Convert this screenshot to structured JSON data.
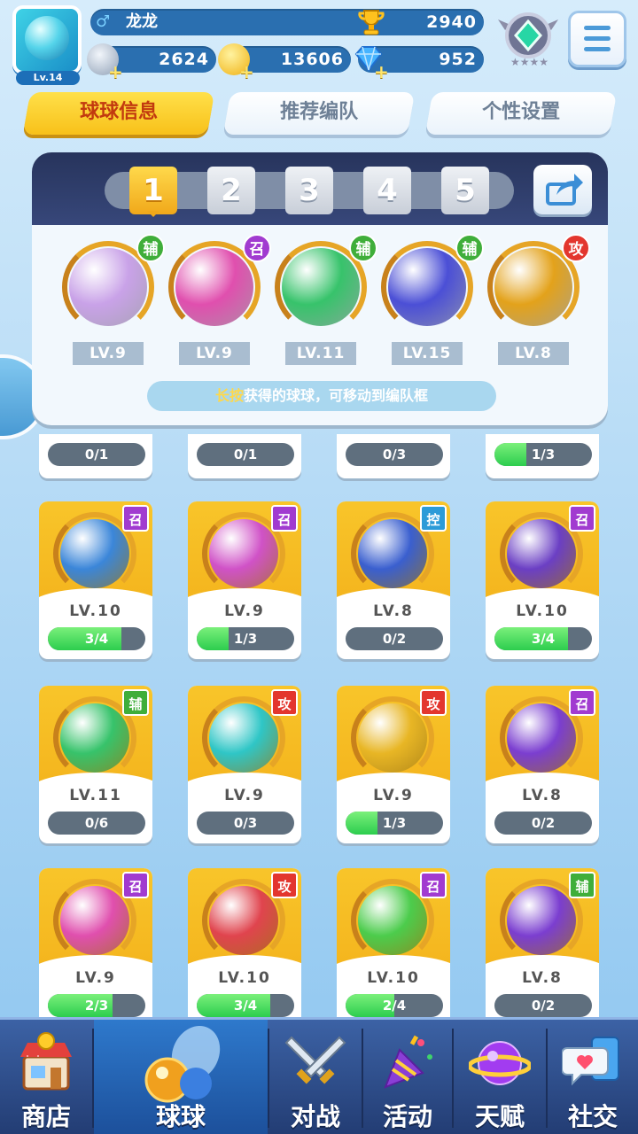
{
  "header": {
    "avatar_level": "Lv.14",
    "gender_icon": "♂",
    "player_name": "龙龙",
    "trophy_score": "2940",
    "silver_coins": "2624",
    "gold_coins": "13606",
    "diamonds": "952"
  },
  "tabs": [
    {
      "label": "球球信息",
      "active": true
    },
    {
      "label": "推荐编队",
      "active": false
    },
    {
      "label": "个性设置",
      "active": false
    }
  ],
  "team": {
    "slots": [
      "1",
      "2",
      "3",
      "4",
      "5"
    ],
    "active_slot": "1",
    "balls": [
      {
        "type": "辅",
        "level": "LV.9",
        "color": "#c9a2e8"
      },
      {
        "type": "召",
        "level": "LV.9",
        "color": "#e04fae"
      },
      {
        "type": "辅",
        "level": "LV.11",
        "color": "#37c36b"
      },
      {
        "type": "辅",
        "level": "LV.15",
        "color": "#4b4fd6"
      },
      {
        "type": "攻",
        "level": "LV.8",
        "color": "#e3a21b"
      }
    ],
    "hint_key": "长按",
    "hint_rest": "获得的球球，可移动到编队框"
  },
  "stub_row": [
    {
      "progress": "0/1",
      "fill": 0
    },
    {
      "progress": "0/1",
      "fill": 0
    },
    {
      "progress": "0/3",
      "fill": 0
    },
    {
      "progress": "1/3",
      "fill": 0.33
    }
  ],
  "cards": [
    {
      "type": "召",
      "level": "LV.10",
      "progress": "3/4",
      "fill": 0.75,
      "color": "#3b86d9",
      "icon": "whirlpool-icon"
    },
    {
      "type": "召",
      "level": "LV.9",
      "progress": "1/3",
      "fill": 0.33,
      "color": "#d052c7",
      "icon": "mushroom-cloud-icon"
    },
    {
      "type": "控",
      "level": "LV.8",
      "progress": "0/2",
      "fill": 0,
      "color": "#3a5fcf",
      "icon": "clock-icon"
    },
    {
      "type": "召",
      "level": "LV.10",
      "progress": "3/4",
      "fill": 0.75,
      "color": "#6b3fc4",
      "icon": "ghost-icon"
    },
    {
      "type": "辅",
      "level": "LV.11",
      "progress": "0/6",
      "fill": 0,
      "color": "#37c36b",
      "icon": "arrow-up-icon"
    },
    {
      "type": "攻",
      "level": "LV.9",
      "progress": "0/3",
      "fill": 0,
      "color": "#2fc6c6",
      "icon": "tornado-icon"
    },
    {
      "type": "攻",
      "level": "LV.9",
      "progress": "1/3",
      "fill": 0.33,
      "color": "#e8b625",
      "icon": "crystal-icon"
    },
    {
      "type": "召",
      "level": "LV.8",
      "progress": "0/2",
      "fill": 0,
      "color": "#7b3ed0",
      "icon": "orbit-icon"
    },
    {
      "type": "召",
      "level": "LV.9",
      "progress": "2/3",
      "fill": 0.66,
      "color": "#e04fae",
      "icon": "dagger-icon"
    },
    {
      "type": "攻",
      "level": "LV.10",
      "progress": "3/4",
      "fill": 0.75,
      "color": "#e0444e",
      "icon": "fist-icon"
    },
    {
      "type": "召",
      "level": "LV.10",
      "progress": "2/4",
      "fill": 0.5,
      "color": "#4ccc4c",
      "icon": "star-seal-icon"
    },
    {
      "type": "辅",
      "level": "LV.8",
      "progress": "0/2",
      "fill": 0,
      "color": "#7b3ed0",
      "icon": "leaf-icon"
    }
  ],
  "nav": [
    {
      "label": "商店",
      "icon": "shop-icon"
    },
    {
      "label": "球球",
      "icon": "balls-icon",
      "selected": true
    },
    {
      "label": "对战",
      "icon": "crossed-swords-icon"
    },
    {
      "label": "活动",
      "icon": "party-popper-icon"
    },
    {
      "label": "天赋",
      "icon": "planet-icon"
    },
    {
      "label": "社交",
      "icon": "chat-heart-icon"
    }
  ],
  "tag_colors": {
    "辅": "#3fae3a",
    "召": "#a13bd0",
    "攻": "#e3362e",
    "控": "#2c9bd8"
  }
}
